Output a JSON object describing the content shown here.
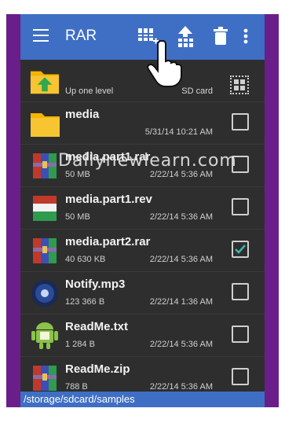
{
  "toolbar": {
    "title": "RAR",
    "icons": [
      "menu-icon",
      "add-to-archive-icon",
      "extract-icon",
      "delete-icon",
      "more-icon"
    ]
  },
  "up_row": {
    "label": "Up one level",
    "location": "SD card"
  },
  "files": [
    {
      "name": "media",
      "size": "",
      "date": "5/31/14 10:21 AM",
      "checked": false,
      "icon": "folder-icon"
    },
    {
      "name": "media.part1.rar",
      "size": "50 MB",
      "date": "2/22/14 5:36 AM",
      "checked": false,
      "icon": "rar-archive-icon"
    },
    {
      "name": "media.part1.rev",
      "size": "50 MB",
      "date": "2/22/14 5:36 AM",
      "checked": false,
      "icon": "rev-file-icon"
    },
    {
      "name": "media.part2.rar",
      "size": "40 630 KB",
      "date": "2/22/14 5:36 AM",
      "checked": true,
      "icon": "rar-archive-icon"
    },
    {
      "name": "Notify.mp3",
      "size": "123 366 B",
      "date": "2/22/14 1:36 AM",
      "checked": false,
      "icon": "audio-file-icon"
    },
    {
      "name": "ReadMe.txt",
      "size": "1 284 B",
      "date": "2/22/14 5:36 AM",
      "checked": false,
      "icon": "android-file-icon"
    },
    {
      "name": "ReadMe.zip",
      "size": "788 B",
      "date": "2/22/14 5:36 AM",
      "checked": false,
      "icon": "rar-archive-icon"
    }
  ],
  "path": "/storage/sdcard/samples",
  "watermark": "Dailynewlearn.com",
  "colors": {
    "toolbar": "#3f6fc4",
    "frame": "#6a1e8a",
    "background": "#2e2e2e",
    "check": "#39b8a8"
  }
}
